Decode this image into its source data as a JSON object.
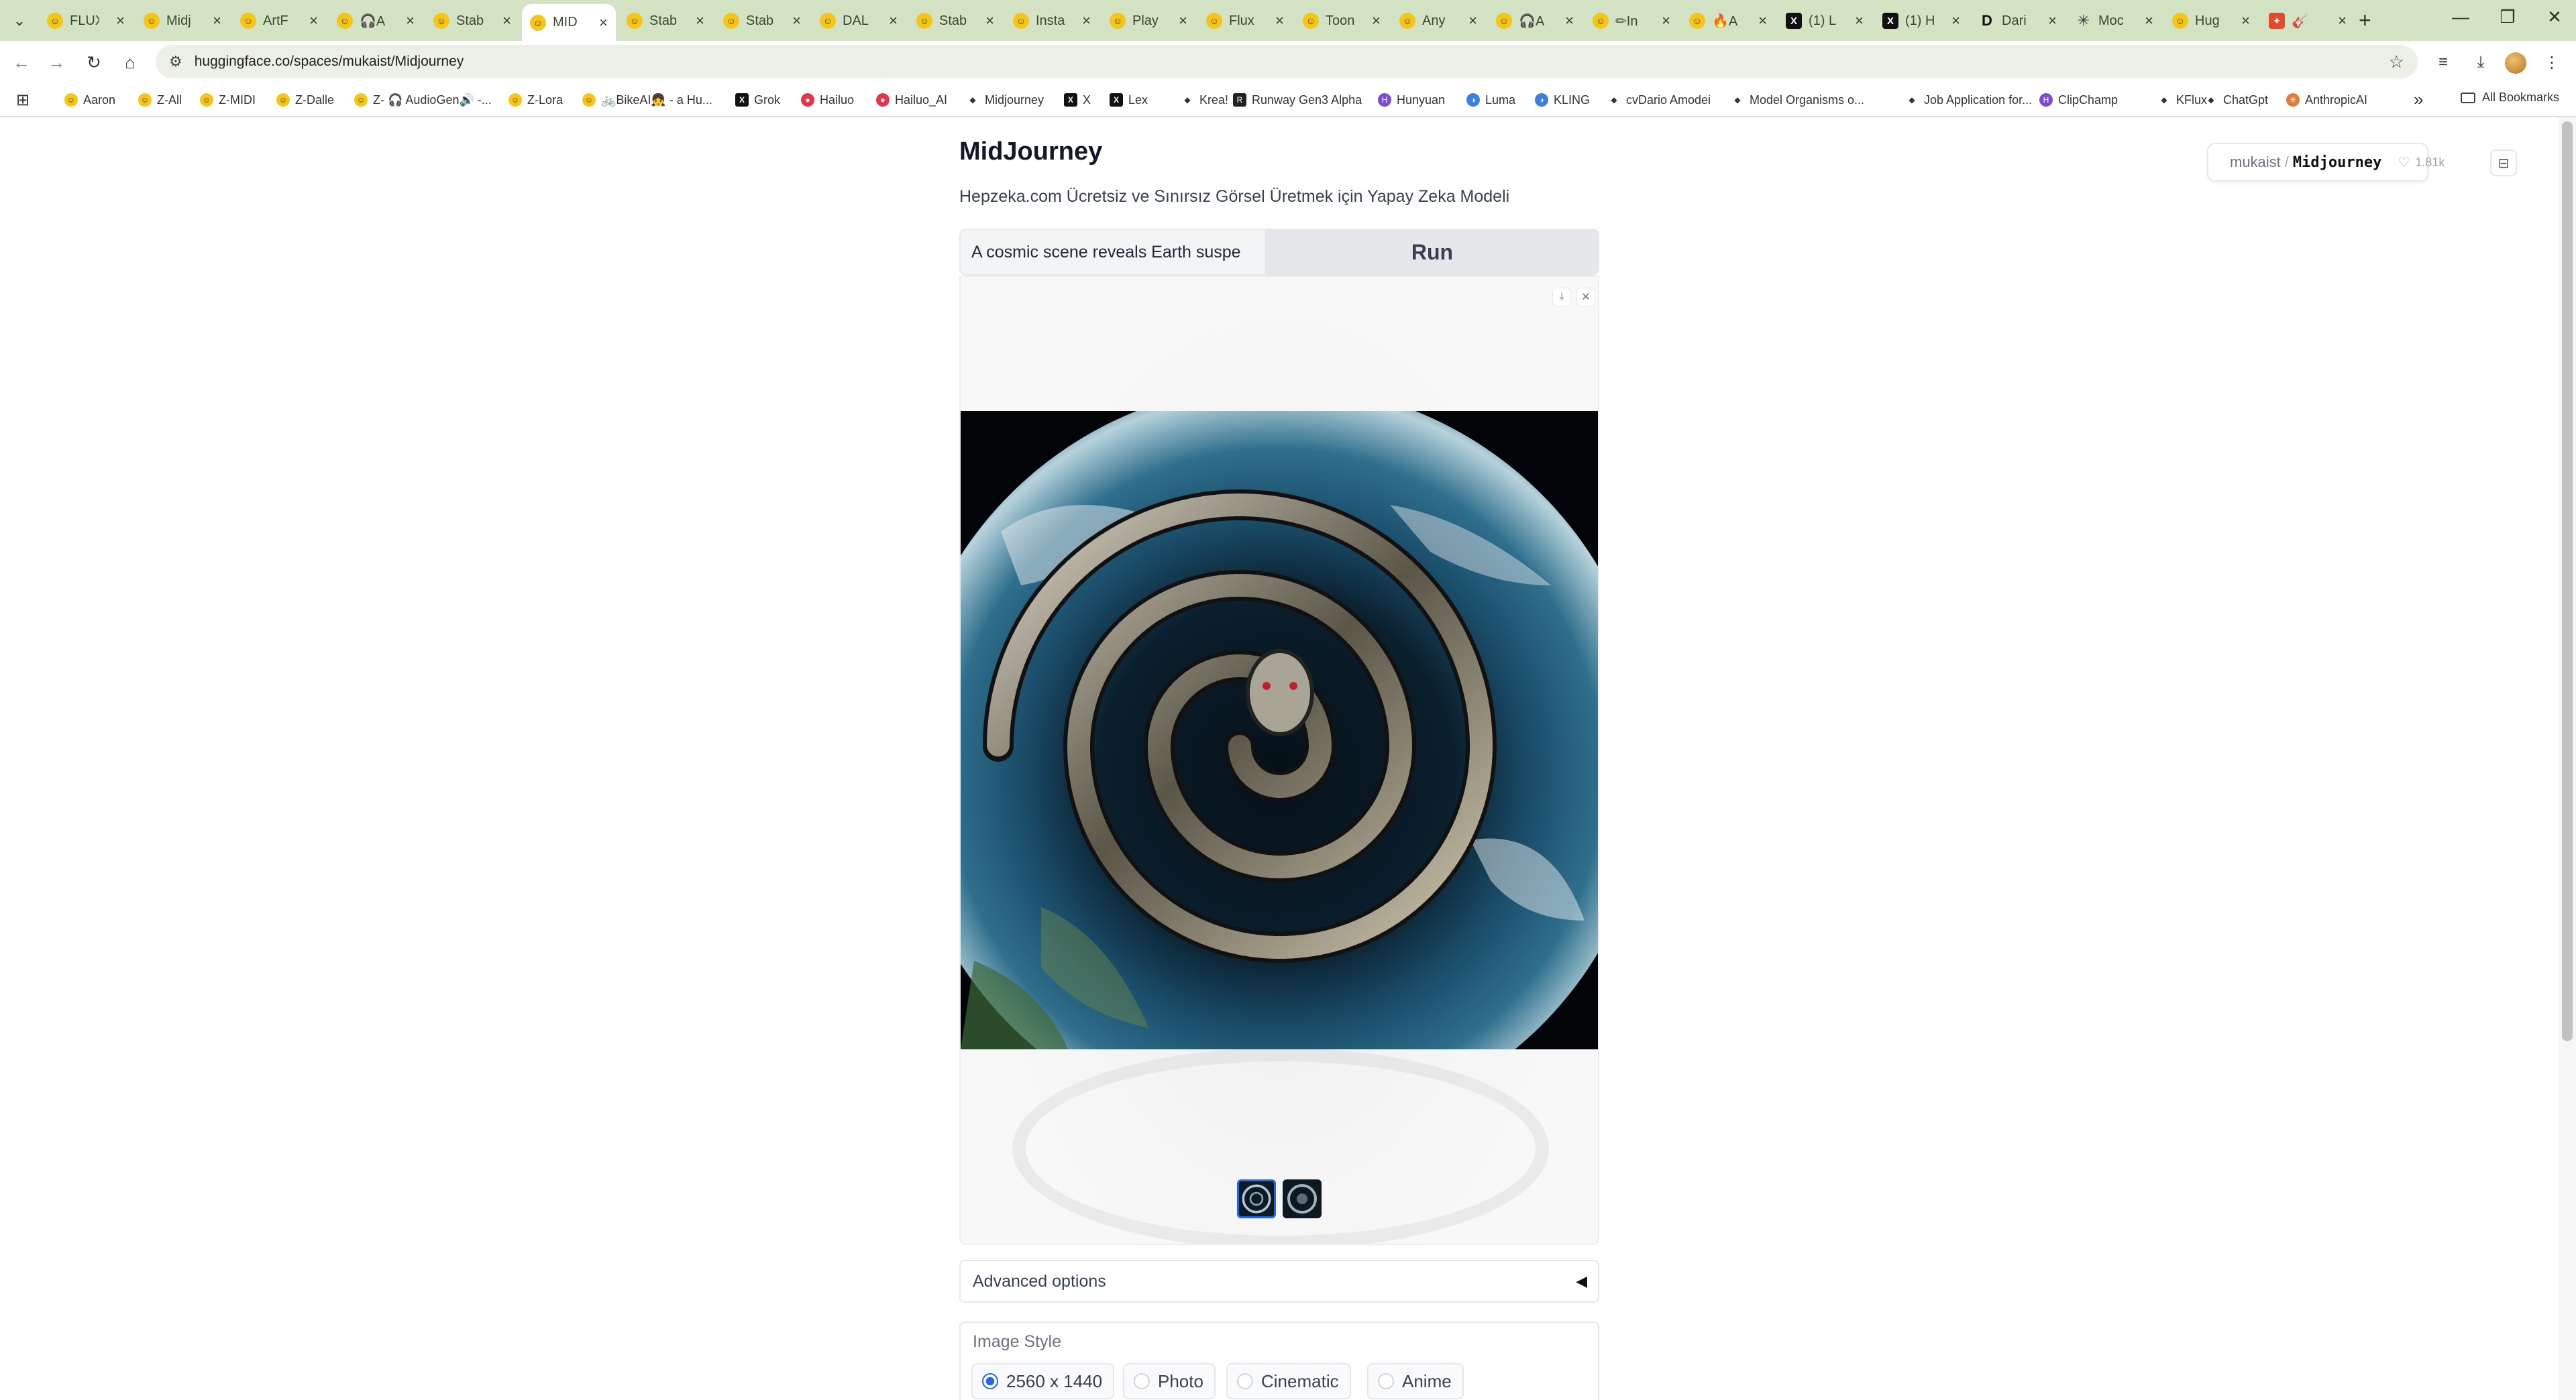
{
  "browser": {
    "tabs": [
      {
        "title": "FLUX",
        "icon": "hf"
      },
      {
        "title": "Midj",
        "icon": "hf"
      },
      {
        "title": "ArtF",
        "icon": "hf"
      },
      {
        "title": "🎧A",
        "icon": "hf"
      },
      {
        "title": "Stab",
        "icon": "hf"
      },
      {
        "title": "MID",
        "icon": "hf",
        "active": true
      },
      {
        "title": "Stab",
        "icon": "hf"
      },
      {
        "title": "Stab",
        "icon": "hf"
      },
      {
        "title": "DAL",
        "icon": "hf"
      },
      {
        "title": "Stab",
        "icon": "hf"
      },
      {
        "title": "Insta",
        "icon": "hf"
      },
      {
        "title": "Play",
        "icon": "hf"
      },
      {
        "title": "Flux",
        "icon": "hf"
      },
      {
        "title": "Toon",
        "icon": "hf"
      },
      {
        "title": "Any",
        "icon": "hf"
      },
      {
        "title": "🎧A",
        "icon": "hf"
      },
      {
        "title": "✏In",
        "icon": "hf"
      },
      {
        "title": "🔥A",
        "icon": "hf"
      },
      {
        "title": "(1) L",
        "icon": "x"
      },
      {
        "title": "(1) H",
        "icon": "x"
      },
      {
        "title": "Dari",
        "icon": "d"
      },
      {
        "title": "Moc",
        "icon": "m"
      },
      {
        "title": "Hug",
        "icon": "hf"
      },
      {
        "title": "🎸",
        "icon": "r"
      }
    ],
    "url": "huggingface.co/spaces/mukaist/Midjourney",
    "bookmarks": [
      {
        "label": "Aaron",
        "icon": "hf"
      },
      {
        "label": "Z-All",
        "icon": "hf"
      },
      {
        "label": "Z-MIDI",
        "icon": "hf"
      },
      {
        "label": "Z-Dalle",
        "icon": "hf"
      },
      {
        "label": "Z- 🎧 AudioGen🔊 -...",
        "icon": "hf"
      },
      {
        "label": "Z-Lora",
        "icon": "hf"
      },
      {
        "label": "🚲BikeAI👧 - a Hu...",
        "icon": "hf"
      },
      {
        "label": "Grok",
        "icon": "x"
      },
      {
        "label": "Hailuo",
        "icon": "red"
      },
      {
        "label": "Hailuo_AI",
        "icon": "red"
      },
      {
        "label": "Midjourney",
        "icon": "none"
      },
      {
        "label": "X",
        "icon": "x"
      },
      {
        "label": "Lex",
        "icon": "x"
      },
      {
        "label": "Krea!",
        "icon": "none"
      },
      {
        "label": "Runway Gen3 Alpha",
        "icon": "dark"
      },
      {
        "label": "Hunyuan",
        "icon": "purple"
      },
      {
        "label": "Luma",
        "icon": "blue"
      },
      {
        "label": "KLING",
        "icon": "blue"
      },
      {
        "label": "cvDario Amodei",
        "icon": "none"
      },
      {
        "label": "Model Organisms o...",
        "icon": "none"
      },
      {
        "label": "Job Application for...",
        "icon": "none"
      },
      {
        "label": "ClipChamp",
        "icon": "purple"
      },
      {
        "label": "KFlux",
        "icon": "none"
      },
      {
        "label": "ChatGpt",
        "icon": "none"
      },
      {
        "label": "AnthropicAI",
        "icon": "orange"
      }
    ],
    "all_bookmarks": "All Bookmarks"
  },
  "space": {
    "owner": "mukaist",
    "repo": "Midjourney",
    "likes": "1.81k"
  },
  "app": {
    "title": "MidJourney",
    "subtitle": "Hepzeka.com Ücretsiz ve Sınırsız Görsel Üretmek için Yapay Zeka Modeli",
    "prompt_value": "A cosmic scene reveals Earth suspe",
    "run_label": "Run",
    "advanced_label": "Advanced options",
    "image_style_label": "Image Style",
    "styles": [
      {
        "label": "2560 x 1440",
        "checked": true
      },
      {
        "label": "Photo",
        "checked": false
      },
      {
        "label": "Cinematic",
        "checked": false
      },
      {
        "label": "Anime",
        "checked": false
      }
    ]
  },
  "colors": {
    "tabstrip": "#d3e3c4",
    "accent_blue": "#2563eb"
  }
}
